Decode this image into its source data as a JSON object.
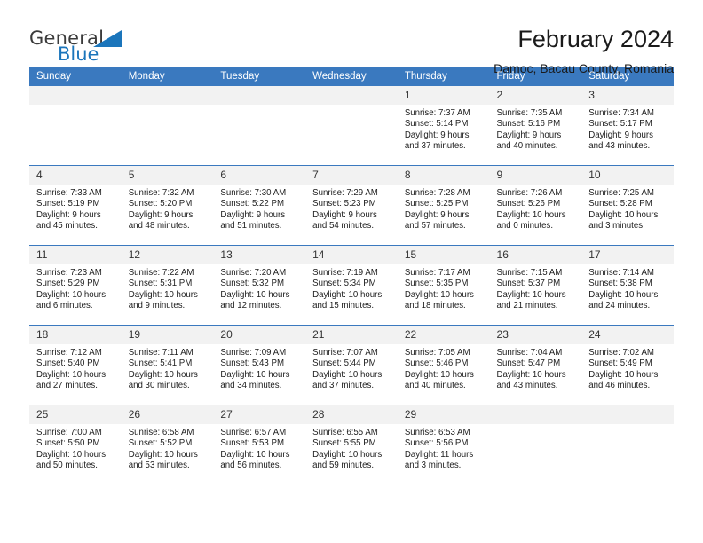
{
  "brand": {
    "name_top": "General",
    "name_bottom": "Blue",
    "triangle_color": "#1b75bb"
  },
  "header": {
    "title": "February 2024",
    "subtitle": "Damoc, Bacau County, Romania"
  },
  "theme": {
    "header_bg": "#3a79bf",
    "daynum_bg": "#f2f2f2",
    "grid_line": "#3a79bf",
    "text": "#202020"
  },
  "labels": {
    "sunrise_prefix": "Sunrise:",
    "sunset_prefix": "Sunset:",
    "daylight_prefix": "Daylight:"
  },
  "weekday_headers": [
    "Sunday",
    "Monday",
    "Tuesday",
    "Wednesday",
    "Thursday",
    "Friday",
    "Saturday"
  ],
  "weeks": [
    [
      {
        "day": "",
        "blank": true
      },
      {
        "day": "",
        "blank": true
      },
      {
        "day": "",
        "blank": true
      },
      {
        "day": "",
        "blank": true
      },
      {
        "day": "1",
        "sunrise": "Sunrise: 7:37 AM",
        "sunset": "Sunset: 5:14 PM",
        "daylight1": "Daylight: 9 hours",
        "daylight2": "and 37 minutes."
      },
      {
        "day": "2",
        "sunrise": "Sunrise: 7:35 AM",
        "sunset": "Sunset: 5:16 PM",
        "daylight1": "Daylight: 9 hours",
        "daylight2": "and 40 minutes."
      },
      {
        "day": "3",
        "sunrise": "Sunrise: 7:34 AM",
        "sunset": "Sunset: 5:17 PM",
        "daylight1": "Daylight: 9 hours",
        "daylight2": "and 43 minutes."
      }
    ],
    [
      {
        "day": "4",
        "sunrise": "Sunrise: 7:33 AM",
        "sunset": "Sunset: 5:19 PM",
        "daylight1": "Daylight: 9 hours",
        "daylight2": "and 45 minutes."
      },
      {
        "day": "5",
        "sunrise": "Sunrise: 7:32 AM",
        "sunset": "Sunset: 5:20 PM",
        "daylight1": "Daylight: 9 hours",
        "daylight2": "and 48 minutes."
      },
      {
        "day": "6",
        "sunrise": "Sunrise: 7:30 AM",
        "sunset": "Sunset: 5:22 PM",
        "daylight1": "Daylight: 9 hours",
        "daylight2": "and 51 minutes."
      },
      {
        "day": "7",
        "sunrise": "Sunrise: 7:29 AM",
        "sunset": "Sunset: 5:23 PM",
        "daylight1": "Daylight: 9 hours",
        "daylight2": "and 54 minutes."
      },
      {
        "day": "8",
        "sunrise": "Sunrise: 7:28 AM",
        "sunset": "Sunset: 5:25 PM",
        "daylight1": "Daylight: 9 hours",
        "daylight2": "and 57 minutes."
      },
      {
        "day": "9",
        "sunrise": "Sunrise: 7:26 AM",
        "sunset": "Sunset: 5:26 PM",
        "daylight1": "Daylight: 10 hours",
        "daylight2": "and 0 minutes."
      },
      {
        "day": "10",
        "sunrise": "Sunrise: 7:25 AM",
        "sunset": "Sunset: 5:28 PM",
        "daylight1": "Daylight: 10 hours",
        "daylight2": "and 3 minutes."
      }
    ],
    [
      {
        "day": "11",
        "sunrise": "Sunrise: 7:23 AM",
        "sunset": "Sunset: 5:29 PM",
        "daylight1": "Daylight: 10 hours",
        "daylight2": "and 6 minutes."
      },
      {
        "day": "12",
        "sunrise": "Sunrise: 7:22 AM",
        "sunset": "Sunset: 5:31 PM",
        "daylight1": "Daylight: 10 hours",
        "daylight2": "and 9 minutes."
      },
      {
        "day": "13",
        "sunrise": "Sunrise: 7:20 AM",
        "sunset": "Sunset: 5:32 PM",
        "daylight1": "Daylight: 10 hours",
        "daylight2": "and 12 minutes."
      },
      {
        "day": "14",
        "sunrise": "Sunrise: 7:19 AM",
        "sunset": "Sunset: 5:34 PM",
        "daylight1": "Daylight: 10 hours",
        "daylight2": "and 15 minutes."
      },
      {
        "day": "15",
        "sunrise": "Sunrise: 7:17 AM",
        "sunset": "Sunset: 5:35 PM",
        "daylight1": "Daylight: 10 hours",
        "daylight2": "and 18 minutes."
      },
      {
        "day": "16",
        "sunrise": "Sunrise: 7:15 AM",
        "sunset": "Sunset: 5:37 PM",
        "daylight1": "Daylight: 10 hours",
        "daylight2": "and 21 minutes."
      },
      {
        "day": "17",
        "sunrise": "Sunrise: 7:14 AM",
        "sunset": "Sunset: 5:38 PM",
        "daylight1": "Daylight: 10 hours",
        "daylight2": "and 24 minutes."
      }
    ],
    [
      {
        "day": "18",
        "sunrise": "Sunrise: 7:12 AM",
        "sunset": "Sunset: 5:40 PM",
        "daylight1": "Daylight: 10 hours",
        "daylight2": "and 27 minutes."
      },
      {
        "day": "19",
        "sunrise": "Sunrise: 7:11 AM",
        "sunset": "Sunset: 5:41 PM",
        "daylight1": "Daylight: 10 hours",
        "daylight2": "and 30 minutes."
      },
      {
        "day": "20",
        "sunrise": "Sunrise: 7:09 AM",
        "sunset": "Sunset: 5:43 PM",
        "daylight1": "Daylight: 10 hours",
        "daylight2": "and 34 minutes."
      },
      {
        "day": "21",
        "sunrise": "Sunrise: 7:07 AM",
        "sunset": "Sunset: 5:44 PM",
        "daylight1": "Daylight: 10 hours",
        "daylight2": "and 37 minutes."
      },
      {
        "day": "22",
        "sunrise": "Sunrise: 7:05 AM",
        "sunset": "Sunset: 5:46 PM",
        "daylight1": "Daylight: 10 hours",
        "daylight2": "and 40 minutes."
      },
      {
        "day": "23",
        "sunrise": "Sunrise: 7:04 AM",
        "sunset": "Sunset: 5:47 PM",
        "daylight1": "Daylight: 10 hours",
        "daylight2": "and 43 minutes."
      },
      {
        "day": "24",
        "sunrise": "Sunrise: 7:02 AM",
        "sunset": "Sunset: 5:49 PM",
        "daylight1": "Daylight: 10 hours",
        "daylight2": "and 46 minutes."
      }
    ],
    [
      {
        "day": "25",
        "sunrise": "Sunrise: 7:00 AM",
        "sunset": "Sunset: 5:50 PM",
        "daylight1": "Daylight: 10 hours",
        "daylight2": "and 50 minutes."
      },
      {
        "day": "26",
        "sunrise": "Sunrise: 6:58 AM",
        "sunset": "Sunset: 5:52 PM",
        "daylight1": "Daylight: 10 hours",
        "daylight2": "and 53 minutes."
      },
      {
        "day": "27",
        "sunrise": "Sunrise: 6:57 AM",
        "sunset": "Sunset: 5:53 PM",
        "daylight1": "Daylight: 10 hours",
        "daylight2": "and 56 minutes."
      },
      {
        "day": "28",
        "sunrise": "Sunrise: 6:55 AM",
        "sunset": "Sunset: 5:55 PM",
        "daylight1": "Daylight: 10 hours",
        "daylight2": "and 59 minutes."
      },
      {
        "day": "29",
        "sunrise": "Sunrise: 6:53 AM",
        "sunset": "Sunset: 5:56 PM",
        "daylight1": "Daylight: 11 hours",
        "daylight2": "and 3 minutes."
      },
      {
        "day": "",
        "blank": true
      },
      {
        "day": "",
        "blank": true
      }
    ]
  ]
}
